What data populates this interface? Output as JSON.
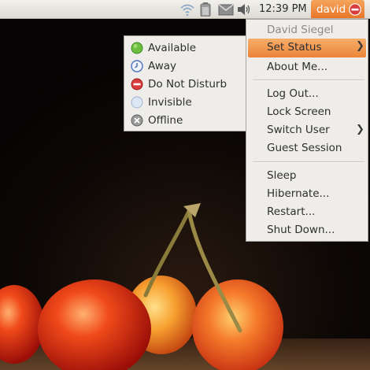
{
  "panel": {
    "clock": "12:39 PM",
    "user_name": "david",
    "tray_icons": [
      "wifi-icon",
      "battery-icon",
      "mail-icon",
      "volume-icon"
    ]
  },
  "user_menu": {
    "header": "David Siegel",
    "set_status": "Set Status",
    "about_me": "About Me...",
    "log_out": "Log Out...",
    "lock_screen": "Lock Screen",
    "switch_user": "Switch User",
    "guest_session": "Guest Session",
    "sleep": "Sleep",
    "hibernate": "Hibernate...",
    "restart": "Restart...",
    "shut_down": "Shut Down..."
  },
  "status_menu": {
    "items": [
      {
        "label": "Available",
        "icon": "available-icon",
        "color": "#5fb336"
      },
      {
        "label": "Away",
        "icon": "away-clock-icon",
        "color": "#5b7fc9"
      },
      {
        "label": "Do Not Disturb",
        "icon": "do-not-disturb-icon",
        "color": "#d23a3a"
      },
      {
        "label": "Invisible",
        "icon": "invisible-icon",
        "color": "#c8d6ec"
      },
      {
        "label": "Offline",
        "icon": "offline-icon",
        "color": "#8a8a8a"
      }
    ]
  },
  "colors": {
    "highlight": "#ea8439",
    "panel": "#e8e6e0",
    "menu_bg": "#efedea"
  }
}
